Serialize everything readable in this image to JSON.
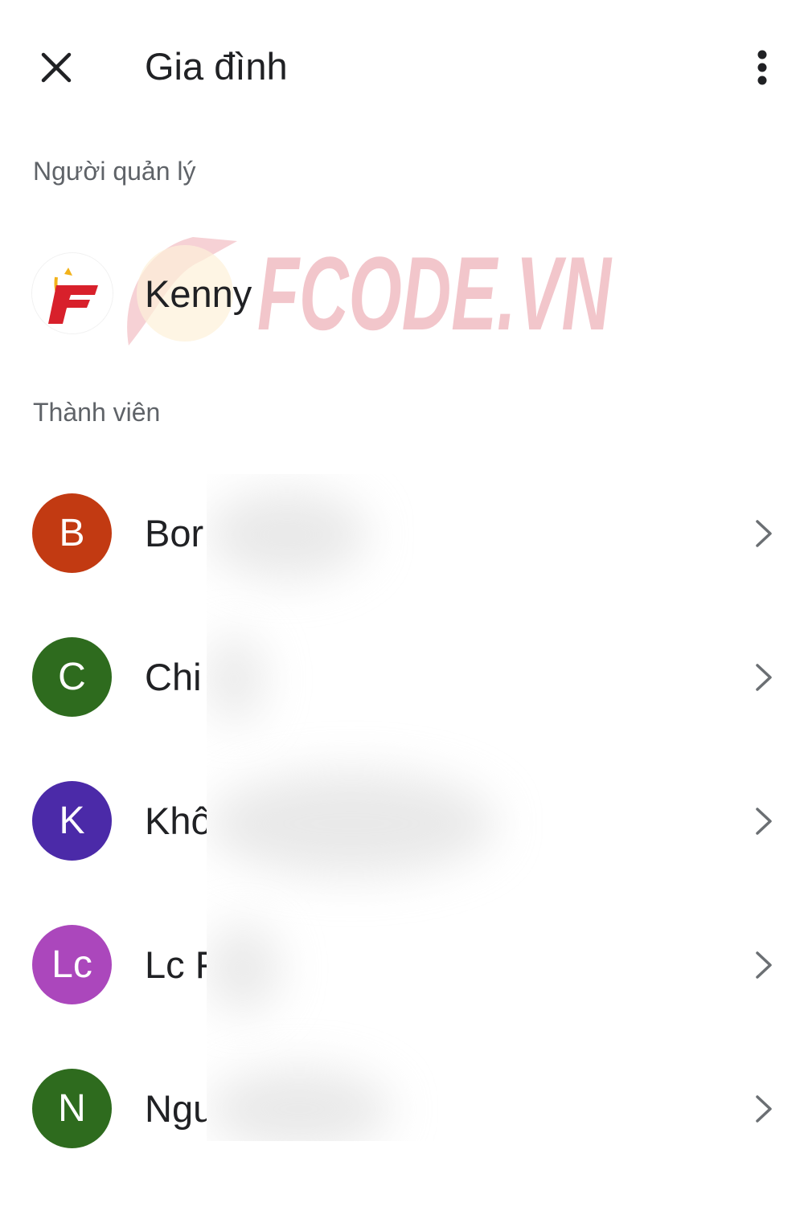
{
  "header": {
    "title": "Gia đình",
    "close_icon": "close-icon",
    "more_icon": "more-vert-icon"
  },
  "manager_section": {
    "label": "Người quản lý",
    "manager": {
      "name": "Kenny",
      "avatar_logo_letter": "F"
    }
  },
  "watermark": {
    "text": "FCODE.VN",
    "color": "#e8a0a8"
  },
  "members_section": {
    "label": "Thành viên",
    "members": [
      {
        "initial": "B",
        "name": "Bor",
        "color": "#c23a12"
      },
      {
        "initial": "C",
        "name": "Chi",
        "color": "#2e6b1e"
      },
      {
        "initial": "K",
        "name": "Khô",
        "color": "#4b2aa8"
      },
      {
        "initial": "Lc",
        "name": "Lc F",
        "color": "#ab47bc"
      },
      {
        "initial": "N",
        "name": "Ngu",
        "color": "#2e6b1e"
      }
    ],
    "chevron_icon": "chevron-right-icon"
  }
}
